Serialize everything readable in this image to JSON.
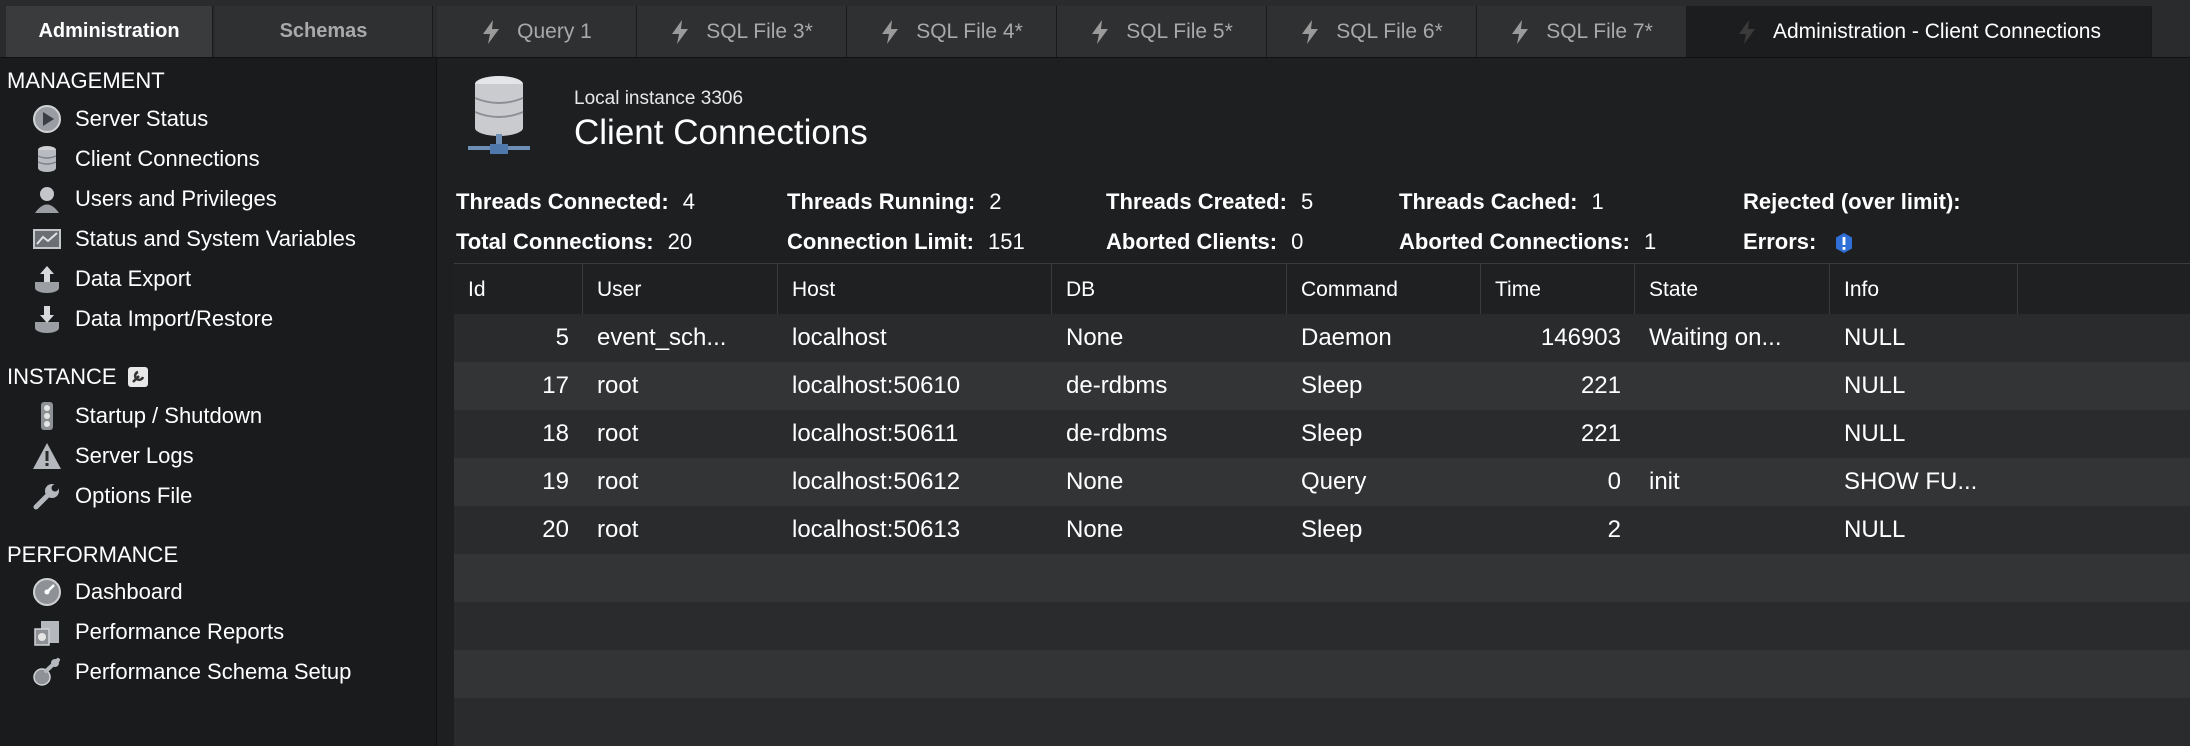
{
  "top_tabs": {
    "sidebar_tabs": [
      {
        "label": "Administration",
        "active": true
      },
      {
        "label": "Schemas",
        "active": false
      }
    ],
    "doc_tabs": [
      {
        "label": "Query 1"
      },
      {
        "label": "SQL File 3*"
      },
      {
        "label": "SQL File 4*"
      },
      {
        "label": "SQL File 5*"
      },
      {
        "label": "SQL File 6*"
      },
      {
        "label": "SQL File 7*"
      },
      {
        "label": "Administration - Client Connections",
        "active": true
      }
    ]
  },
  "sidebar": {
    "management": {
      "heading": "MANAGEMENT",
      "items": [
        {
          "label": "Server Status",
          "icon": "server-status-icon"
        },
        {
          "label": "Client Connections",
          "icon": "database-icon"
        },
        {
          "label": "Users and Privileges",
          "icon": "user-icon"
        },
        {
          "label": "Status and System Variables",
          "icon": "monitor-icon"
        },
        {
          "label": "Data Export",
          "icon": "export-icon"
        },
        {
          "label": "Data Import/Restore",
          "icon": "import-icon"
        }
      ]
    },
    "instance": {
      "heading": "INSTANCE",
      "items": [
        {
          "label": "Startup / Shutdown",
          "icon": "traffic-light-icon"
        },
        {
          "label": "Server Logs",
          "icon": "warning-icon"
        },
        {
          "label": "Options File",
          "icon": "wrench-icon"
        }
      ]
    },
    "performance": {
      "heading": "PERFORMANCE",
      "items": [
        {
          "label": "Dashboard",
          "icon": "gauge-icon"
        },
        {
          "label": "Performance Reports",
          "icon": "reports-icon"
        },
        {
          "label": "Performance Schema Setup",
          "icon": "schema-setup-icon"
        }
      ]
    }
  },
  "header": {
    "instance": "Local instance 3306",
    "title": "Client Connections"
  },
  "stats": {
    "threads_connected": {
      "label": "Threads Connected:",
      "value": "4"
    },
    "threads_running": {
      "label": "Threads Running:",
      "value": "2"
    },
    "threads_created": {
      "label": "Threads Created:",
      "value": "5"
    },
    "threads_cached": {
      "label": "Threads Cached:",
      "value": "1"
    },
    "rejected": {
      "label": "Rejected (over limit):",
      "value": ""
    },
    "total_connections": {
      "label": "Total Connections:",
      "value": "20"
    },
    "connection_limit": {
      "label": "Connection Limit:",
      "value": "151"
    },
    "aborted_clients": {
      "label": "Aborted Clients:",
      "value": "0"
    },
    "aborted_connections": {
      "label": "Aborted Connections:",
      "value": "1"
    },
    "errors": {
      "label": "Errors:",
      "icon": "info-badge-icon"
    }
  },
  "table": {
    "columns": [
      "Id",
      "User",
      "Host",
      "DB",
      "Command",
      "Time",
      "State",
      "Info"
    ],
    "rows": [
      [
        "5",
        "event_sch...",
        "localhost",
        "None",
        "Daemon",
        "146903",
        "Waiting on...",
        "NULL"
      ],
      [
        "17",
        "root",
        "localhost:50610",
        "de-rdbms",
        "Sleep",
        "221",
        "",
        "NULL"
      ],
      [
        "18",
        "root",
        "localhost:50611",
        "de-rdbms",
        "Sleep",
        "221",
        "",
        "NULL"
      ],
      [
        "19",
        "root",
        "localhost:50612",
        "None",
        "Query",
        "0",
        "init",
        "SHOW FU..."
      ],
      [
        "20",
        "root",
        "localhost:50613",
        "None",
        "Sleep",
        "2",
        "",
        "NULL"
      ]
    ]
  }
}
